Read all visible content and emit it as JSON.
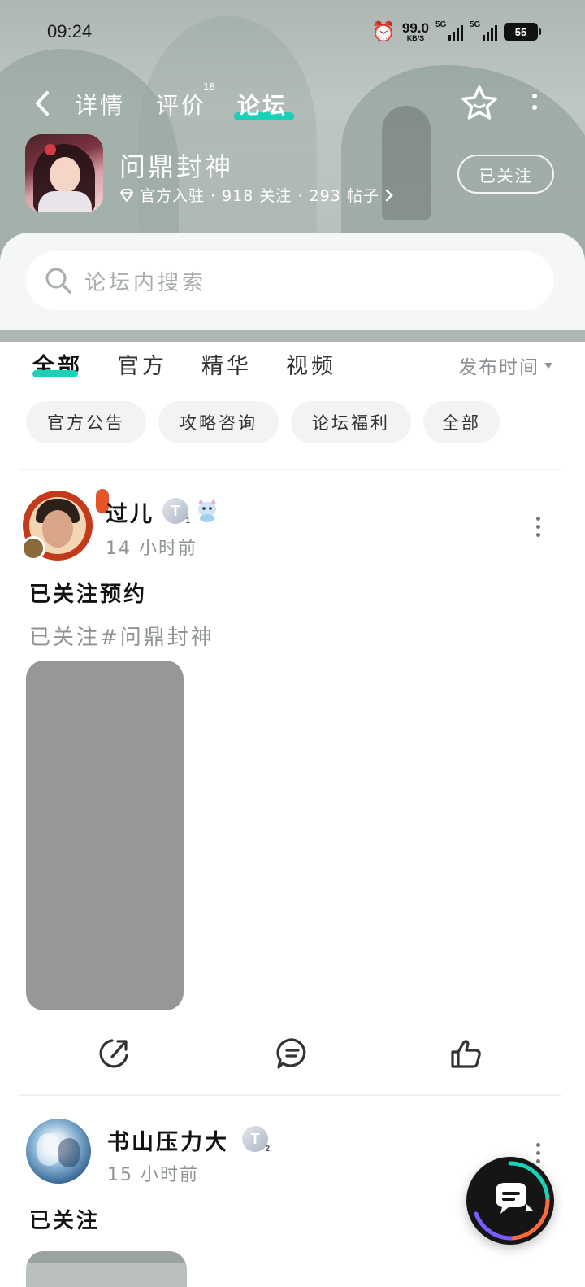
{
  "status_bar": {
    "time": "09:24",
    "net_speed": "99.0",
    "net_unit": "KB/S",
    "sig1": "5G",
    "sig2": "5G",
    "battery": "55"
  },
  "nav": {
    "tabs": [
      {
        "label": "详情"
      },
      {
        "label": "评价",
        "count": "18"
      },
      {
        "label": "论坛",
        "active": true
      }
    ]
  },
  "game": {
    "title": "问鼎封神",
    "meta": "官方入驻 · 918 关注 · 293 帖子",
    "follow_label": "已关注",
    "icon": "game-icon"
  },
  "search": {
    "placeholder": "论坛内搜索"
  },
  "filter_tabs": [
    {
      "label": "全部",
      "active": true
    },
    {
      "label": "官方"
    },
    {
      "label": "精华"
    },
    {
      "label": "视频"
    }
  ],
  "sort": {
    "label": "发布时间"
  },
  "chips": [
    "官方公告",
    "攻略咨询",
    "论坛福利",
    "全部"
  ],
  "posts": [
    {
      "user": "过儿",
      "level": "T",
      "level_num": "1",
      "time": "14 小时前",
      "title": "已关注预约",
      "body": "已关注#问鼎封神"
    },
    {
      "user": "书山压力大",
      "level": "T",
      "level_num": "2",
      "time": "15 小时前",
      "title": "已关注"
    }
  ],
  "colors": {
    "accent": "#19d1b8",
    "image_placeholder": "#959897",
    "muted_text": "#8e9396"
  },
  "icons": [
    "back-icon",
    "star-face-icon",
    "more-icon",
    "diamond-icon",
    "chevron-right-icon",
    "search-icon",
    "share-icon",
    "comment-icon",
    "like-icon",
    "chat-icon",
    "alarm-icon"
  ]
}
